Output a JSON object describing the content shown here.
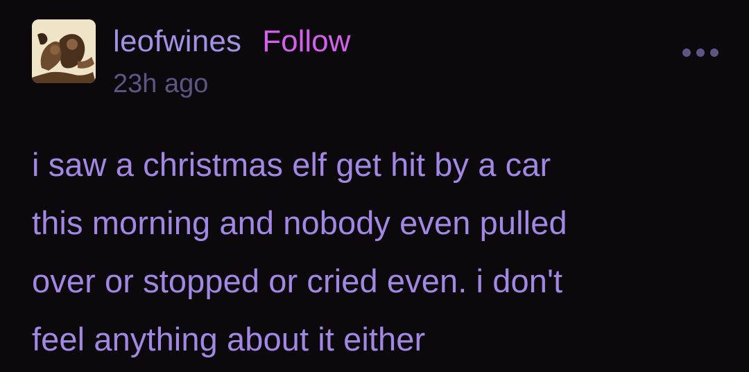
{
  "post": {
    "author": {
      "username": "leofwines",
      "avatar_icon": "user-avatar-photo"
    },
    "follow_label": "Follow",
    "timestamp": "23h ago",
    "more_menu_icon": "more-horizontal-icon",
    "content_lines": [
      "i saw a christmas elf get hit by a car",
      "this morning and nobody even pulled",
      "over or stopped or cried even. i don't",
      "feel anything about it either"
    ]
  },
  "colors": {
    "background": "#0b090c",
    "username": "#a391e3",
    "follow": "#d660ee",
    "timestamp": "#5d5584",
    "body_text": "#a287e4",
    "more_dots": "#5d5584"
  }
}
